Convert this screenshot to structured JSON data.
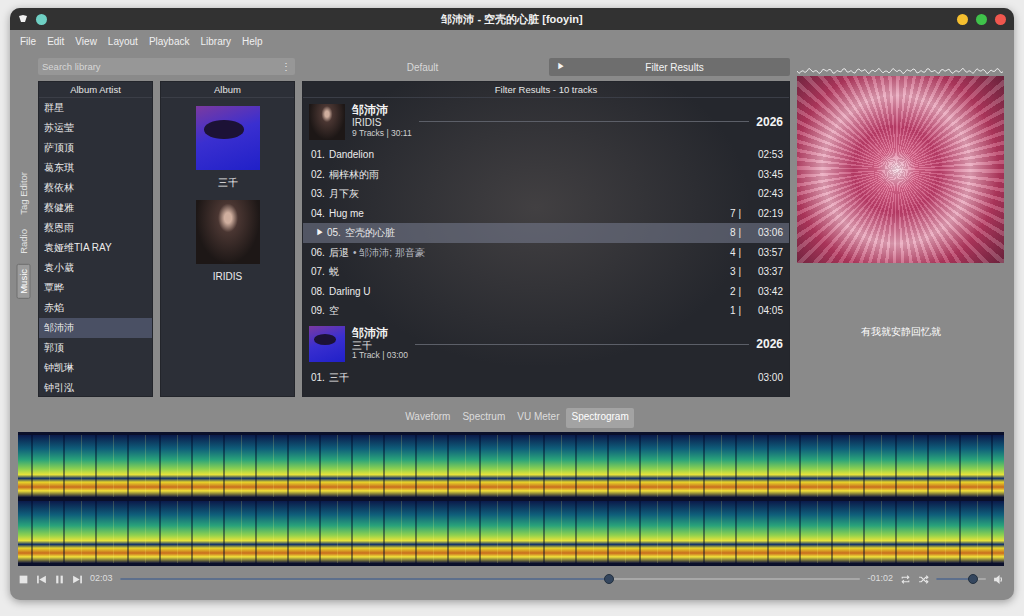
{
  "window": {
    "title": "邹沛沛 - 空壳的心脏 [fooyin]"
  },
  "menu": [
    "File",
    "Edit",
    "View",
    "Layout",
    "Playback",
    "Library",
    "Help"
  ],
  "side_tabs": [
    {
      "label": "Tag Editor",
      "selected": false
    },
    {
      "label": "Radio",
      "selected": false
    },
    {
      "label": "Music",
      "selected": true
    }
  ],
  "search": {
    "placeholder": "Search library",
    "menu_icon": "⋮"
  },
  "layout_tabs": [
    {
      "label": "Default",
      "selected": false
    },
    {
      "label": "Filter Results",
      "selected": true,
      "icon": "▶"
    }
  ],
  "artists": {
    "header": "Album Artist",
    "items": [
      {
        "name": "群星",
        "selected": false
      },
      {
        "name": "苏运莹",
        "selected": false
      },
      {
        "name": "萨顶顶",
        "selected": false
      },
      {
        "name": "葛东琪",
        "selected": false
      },
      {
        "name": "蔡依林",
        "selected": false
      },
      {
        "name": "蔡健雅",
        "selected": false
      },
      {
        "name": "蔡恩雨",
        "selected": false
      },
      {
        "name": "袁娅维TIA RAY",
        "selected": false
      },
      {
        "name": "袁小葳",
        "selected": false
      },
      {
        "name": "覃晔",
        "selected": false
      },
      {
        "name": "赤焰",
        "selected": false
      },
      {
        "name": "邹沛沛",
        "selected": true
      },
      {
        "name": "郭顶",
        "selected": false
      },
      {
        "name": "钟凯琳",
        "selected": false
      },
      {
        "name": "钟引泓",
        "selected": false
      }
    ]
  },
  "albums": {
    "header": "Album",
    "items": [
      {
        "title": "三千",
        "selected": false
      },
      {
        "title": "IRIDIS",
        "selected": false
      }
    ]
  },
  "playlist": {
    "header": "Filter Results - 10 tracks",
    "playing_icon": "▶",
    "groups": [
      {
        "artist": "邹沛沛",
        "album": "IRIDIS",
        "info": "9 Tracks | 30:11",
        "year": "2026",
        "tracks": [
          {
            "number": "01.",
            "title": "Dandelion",
            "extra": "",
            "plays": "",
            "duration": "02:53",
            "playing": false,
            "selected": false
          },
          {
            "number": "02.",
            "title": "桐梓林的雨",
            "extra": "",
            "plays": "",
            "duration": "03:45",
            "playing": false,
            "selected": false
          },
          {
            "number": "03.",
            "title": "月下灰",
            "extra": "",
            "plays": "",
            "duration": "02:43",
            "playing": false,
            "selected": false
          },
          {
            "number": "04.",
            "title": "Hug me",
            "extra": "",
            "plays": "7 |",
            "duration": "02:19",
            "playing": false,
            "selected": false
          },
          {
            "number": "05.",
            "title": "空壳的心脏",
            "extra": "",
            "plays": "8 |",
            "duration": "03:06",
            "playing": true,
            "selected": true
          },
          {
            "number": "06.",
            "title": "后退",
            "extra": "• 邹沛沛; 那音豪",
            "plays": "4 |",
            "duration": "03:57",
            "playing": false,
            "selected": false
          },
          {
            "number": "07.",
            "title": "蜕",
            "extra": "",
            "plays": "3 |",
            "duration": "03:37",
            "playing": false,
            "selected": false
          },
          {
            "number": "08.",
            "title": "Darling U",
            "extra": "",
            "plays": "2 |",
            "duration": "03:42",
            "playing": false,
            "selected": false
          },
          {
            "number": "09.",
            "title": "空",
            "extra": "",
            "plays": "1 |",
            "duration": "04:05",
            "playing": false,
            "selected": false
          }
        ]
      },
      {
        "artist": "邹沛沛",
        "album": "三千",
        "info": "1 Track | 03:00",
        "year": "2026",
        "tracks": [
          {
            "number": "01.",
            "title": "三千",
            "extra": "",
            "plays": "",
            "duration": "03:00",
            "playing": false,
            "selected": false
          }
        ]
      }
    ]
  },
  "lyrics": {
    "lines": [
      {
        "text": "有我就安静回忆就",
        "current": true
      }
    ]
  },
  "visualizer_tabs": [
    {
      "label": "Waveform",
      "selected": false
    },
    {
      "label": "Spectrum",
      "selected": false
    },
    {
      "label": "VU Meter",
      "selected": false
    },
    {
      "label": "Spectrogram",
      "selected": true
    }
  ],
  "playback": {
    "elapsed": "02:03",
    "remaining": "-01:02",
    "seek": {
      "level": 0.66
    },
    "volume": {
      "level": 0.74
    }
  }
}
